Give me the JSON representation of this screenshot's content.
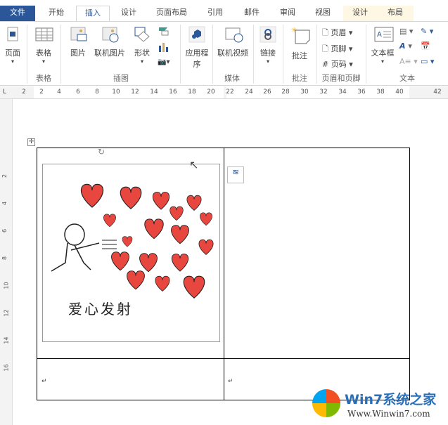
{
  "tabs": [
    "文件",
    "开始",
    "插入",
    "设计",
    "页面布局",
    "引用",
    "邮件",
    "审阅",
    "视图",
    "设计",
    "布局"
  ],
  "ribbon": {
    "page": "页面",
    "table": "表格",
    "picture": "图片",
    "online_picture": "联机图片",
    "shapes": "形状",
    "apps": "应用程",
    "apps2": "序",
    "online_video": "联机视频",
    "link": "链接",
    "comment": "批注",
    "header": "页眉",
    "footer": "页脚",
    "page_number": "页码",
    "textbox": "文本框",
    "groups": {
      "table": "表格",
      "illustrations": "插图",
      "media": "媒体",
      "comments": "批注",
      "header_footer": "页眉和页脚",
      "text": "文本"
    }
  },
  "ruler": [
    "2",
    "2",
    "4",
    "6",
    "8",
    "10",
    "12",
    "14",
    "16",
    "18",
    "20",
    "22",
    "24",
    "26",
    "28",
    "30",
    "32",
    "34",
    "36",
    "38",
    "40",
    "42"
  ],
  "vruler": [
    "2",
    "4",
    "6",
    "8",
    "10",
    "12",
    "14",
    "16"
  ],
  "document": {
    "image_caption": "爱心发射",
    "paragraph_mark": "↵"
  },
  "watermark": {
    "title": "Win7系统之家",
    "url": "Www.Winwin7.com"
  },
  "colors": {
    "accent": "#2b579a",
    "heart": "#e8473f"
  }
}
